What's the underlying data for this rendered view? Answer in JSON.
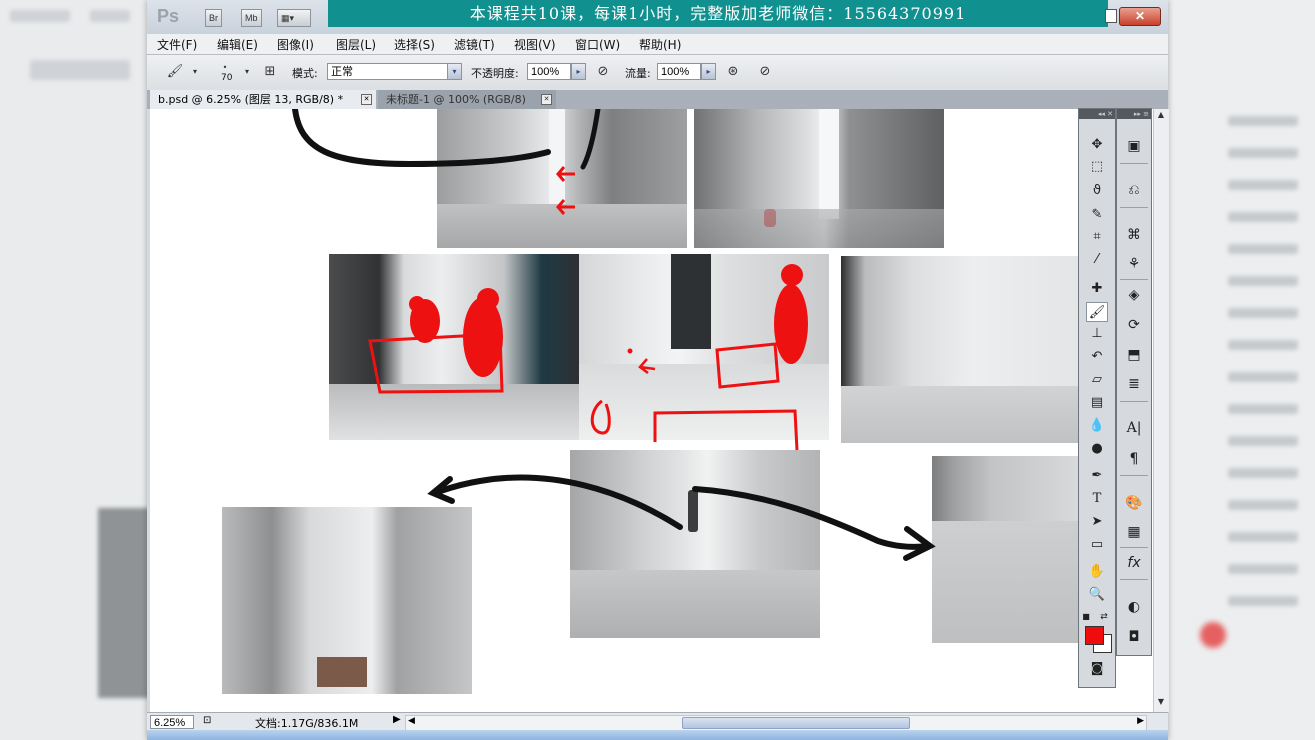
{
  "app": {
    "logo": "Ps",
    "bridge_btn": "Br",
    "minibridge_btn": "Mb",
    "screen_mode_btn": "▾"
  },
  "banner": {
    "text": "本课程共10课，每课1小时，完整版加老师微信：15564370991"
  },
  "window_controls": {
    "close": "✕"
  },
  "menu": {
    "items": [
      "文件(F)",
      "编辑(E)",
      "图像(I)",
      "图层(L)",
      "选择(S)",
      "滤镜(T)",
      "视图(V)",
      "窗口(W)",
      "帮助(H)"
    ]
  },
  "options": {
    "brush_size": "70",
    "mode_label": "模式:",
    "mode_value": "正常",
    "opacity_label": "不透明度:",
    "opacity_value": "100%",
    "flow_label": "流量:",
    "flow_value": "100%"
  },
  "tabs": [
    {
      "label": "b.psd @ 6.25% (图层 13, RGB/8) *",
      "active": true
    },
    {
      "label": "未标题-1 @ 100% (RGB/8)",
      "active": false
    }
  ],
  "status": {
    "zoom": "6.25%",
    "doc_info": "文档:1.17G/836.1M"
  },
  "colors": {
    "banner_bg": "#10918f",
    "foreground_color": "#ee0c0c",
    "background_color": "#ffffff",
    "annotation_red": "#ee1111"
  },
  "tools": [
    "move-icon",
    "marquee-icon",
    "lasso-icon",
    "quick-select-icon",
    "crop-icon",
    "eyedropper-icon",
    "healing-icon",
    "brush-icon",
    "stamp-icon",
    "history-brush-icon",
    "eraser-icon",
    "gradient-icon",
    "blur-icon",
    "dodge-icon",
    "pen-icon",
    "type-icon",
    "path-select-icon",
    "shape-icon",
    "hand-icon",
    "zoom-icon"
  ],
  "panels": [
    "navigator-icon",
    "history-icon",
    "brush-presets-icon",
    "clone-source-icon",
    "layers-icon",
    "channels-icon",
    "transform-icon",
    "paths-icon",
    "character-icon",
    "paragraph-icon",
    "swatches-icon",
    "grid-icon",
    "styles-icon",
    "adjustments-icon",
    "masks-icon"
  ]
}
